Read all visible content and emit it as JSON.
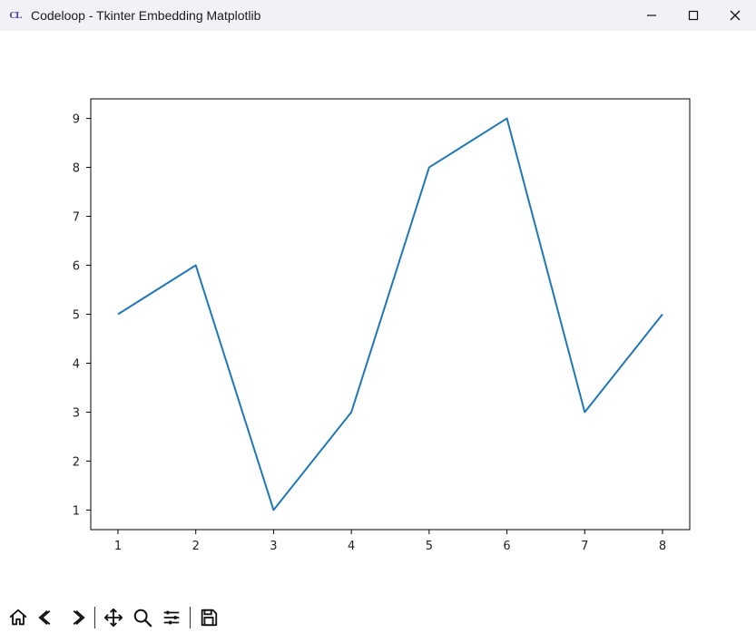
{
  "window": {
    "title": "Codeloop - Tkinter Embedding Matplotlib",
    "app_icon_text": "CL"
  },
  "chart_data": {
    "type": "line",
    "x": [
      1,
      2,
      3,
      4,
      5,
      6,
      7,
      8
    ],
    "y": [
      5,
      6,
      1,
      3,
      8,
      9,
      3,
      5
    ],
    "xticks": [
      1,
      2,
      3,
      4,
      5,
      6,
      7,
      8
    ],
    "yticks": [
      1,
      2,
      3,
      4,
      5,
      6,
      7,
      8,
      9
    ],
    "xlim": [
      0.65,
      8.35
    ],
    "ylim": [
      0.6,
      9.4
    ],
    "line_color": "#1f77b4"
  },
  "toolbar": {
    "home": "Home",
    "back": "Back",
    "forward": "Forward",
    "pan": "Pan",
    "zoom": "Zoom",
    "configure": "Configure subplots",
    "save": "Save"
  },
  "window_controls": {
    "minimize": "Minimize",
    "maximize": "Maximize",
    "close": "Close"
  }
}
